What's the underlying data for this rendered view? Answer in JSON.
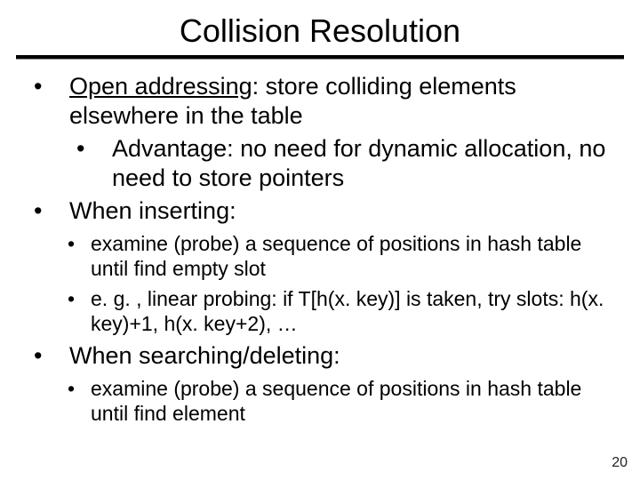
{
  "title": "Collision Resolution",
  "b1": {
    "term": "Open addressing",
    "rest": ": store colliding elements elsewhere in the table",
    "sub1": "Advantage: no need for dynamic allocation, no need to store pointers"
  },
  "b2": {
    "text": "When inserting:",
    "sub1": "examine (probe) a sequence of positions in hash table until find empty slot",
    "sub2": "e. g. , linear probing: if T[h(x. key)] is taken, try slots: h(x. key)+1, h(x. key+2), …"
  },
  "b3": {
    "text": "When searching/deleting:",
    "sub1": "examine (probe) a sequence of positions in hash table until find element"
  },
  "page_number": "20"
}
